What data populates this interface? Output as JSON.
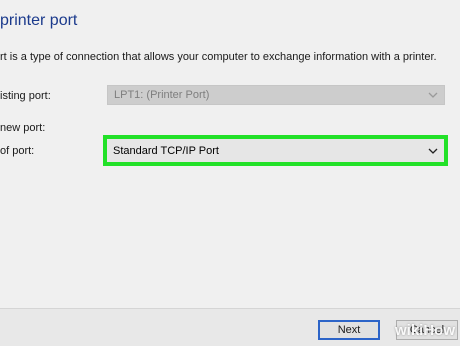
{
  "dialog": {
    "title": "printer port",
    "description": "rt is a type of connection that allows your computer to exchange information with a printer."
  },
  "existing_port": {
    "label": "isting port:",
    "value": "LPT1: (Printer Port)"
  },
  "new_port": {
    "label": "new port:",
    "type_label": "of port:",
    "value": "Standard TCP/IP Port"
  },
  "buttons": {
    "next": "Next",
    "cancel": "Cancel"
  },
  "watermark": "wikiHow",
  "colors": {
    "highlight": "#22e128",
    "title": "#1b3a8c"
  },
  "icons": {
    "dropdown": "chevron-down-icon"
  }
}
